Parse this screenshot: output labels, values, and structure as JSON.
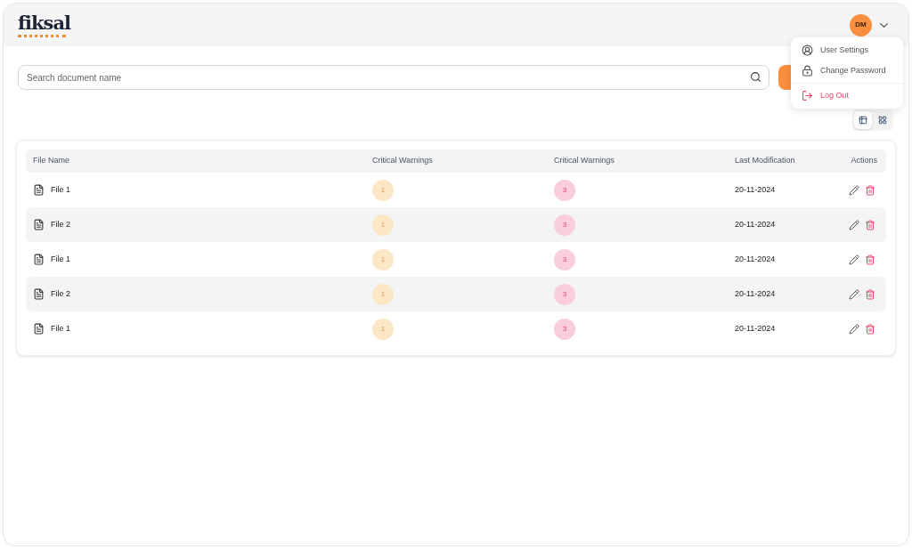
{
  "header": {
    "logo": "fiksal",
    "avatar": "DM"
  },
  "search": {
    "placeholder": "Search document name"
  },
  "user_menu": {
    "items": [
      {
        "label": "User Settings",
        "kind": "settings"
      },
      {
        "label": "Change Password",
        "kind": "password"
      },
      {
        "label": "Log Out",
        "kind": "logout"
      }
    ]
  },
  "view_toggle": [
    {
      "kind": "table",
      "selected": true
    },
    {
      "kind": "grid",
      "selected": false
    }
  ],
  "table": {
    "columns": [
      "File Name",
      "Critical Warnings",
      "Critical Warnings",
      "Last Modification",
      "Actions"
    ],
    "rows": [
      {
        "file": "File 1",
        "warnings_1": "1",
        "warnings_2": "3",
        "modified": "20-11-2024"
      },
      {
        "file": "File 2",
        "warnings_1": "1",
        "warnings_2": "3",
        "modified": "20-11-2024"
      },
      {
        "file": "File 1",
        "warnings_1": "1",
        "warnings_2": "3",
        "modified": "20-11-2024"
      },
      {
        "file": "File 2",
        "warnings_1": "1",
        "warnings_2": "3",
        "modified": "20-11-2024"
      },
      {
        "file": "File 1",
        "warnings_1": "1",
        "warnings_2": "3",
        "modified": "20-11-2024"
      }
    ]
  }
}
